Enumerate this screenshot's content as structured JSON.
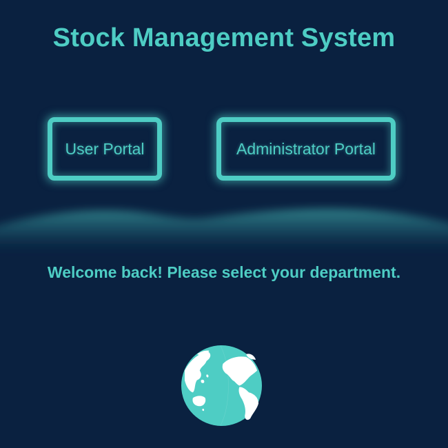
{
  "header": {
    "title": "Stock Management System"
  },
  "portals": {
    "user_label": "User Portal",
    "admin_label": "Administrator Portal"
  },
  "message": {
    "welcome": "Welcome back! Please select your department."
  },
  "icons": {
    "globe": "globe-icon"
  },
  "colors": {
    "background": "#0a2140",
    "accent": "#4ecdc4"
  }
}
